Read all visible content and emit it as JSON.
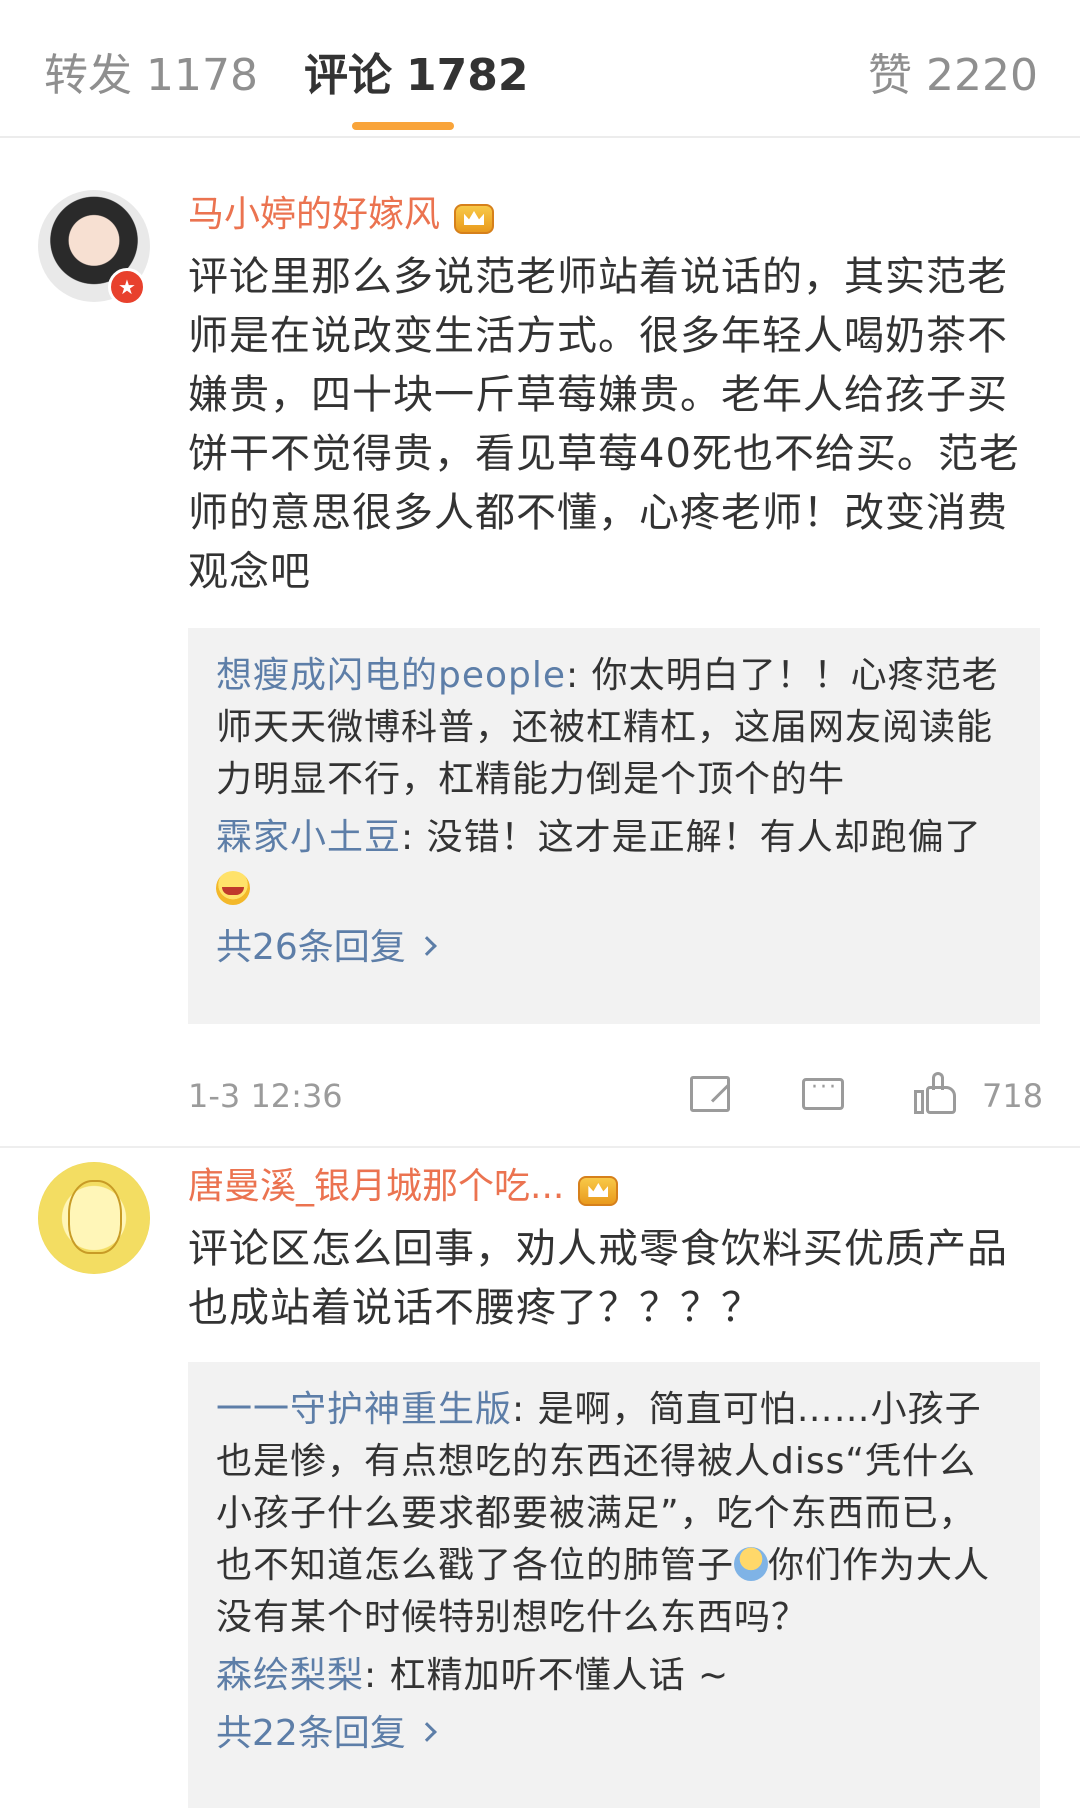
{
  "tabs": {
    "reposts": {
      "label": "转发",
      "count": "1178"
    },
    "comments": {
      "label": "评论",
      "count": "1782"
    },
    "likes": {
      "label": "赞",
      "count": "2220"
    }
  },
  "colors": {
    "accent": "#f9a43a",
    "username": "#eb7350",
    "reply_name": "#5d7ea8",
    "meta": "#9b9b9b"
  },
  "comments": [
    {
      "username": "马小婷的好嫁风",
      "badge_icon": "crown-icon",
      "verified_badge": "★",
      "text": "评论里那么多说范老师站着说话的，其实范老师是在说改变生活方式。很多年轻人喝奶茶不嫌贵，四十块一斤草莓嫌贵。老年人给孩子买饼干不觉得贵，看见草莓40死也不给买。范老师的意思很多人都不懂，心疼老师！改变消费观念吧",
      "replies": [
        {
          "name": "想瘦成闪电的people",
          "text": ": 你太明白了！！心疼范老师天天微博科普，还被杠精杠，这届网友阅读能力明显不行，杠精能力倒是个顶个的牛"
        },
        {
          "name": "霖家小土豆",
          "text": ": 没错！这才是正解！有人却跑偏了"
        }
      ],
      "more_replies": "共26条回复",
      "time": "1-3 12:36",
      "likes": "718"
    },
    {
      "username": "唐曼溪_银月城那个吃...",
      "badge_icon": "crown-icon",
      "text": "评论区怎么回事，劝人戒零食饮料买优质产品也成站着说话不腰疼了？？？？",
      "replies": [
        {
          "name": "一一守护神重生版",
          "text": ": 是啊，简直可怕……小孩子也是惨，有点想吃的东西还得被人diss“凭什么小孩子什么要求都要被满足”，吃个东西而已，也不知道怎么戳了各位的肺管子",
          "text_after_emoji": "你们作为大人没有某个时候特别想吃什么东西吗？"
        },
        {
          "name": "森绘梨梨",
          "text": ": 杠精加听不懂人话 ~"
        }
      ],
      "more_replies": "共22条回复"
    }
  ]
}
